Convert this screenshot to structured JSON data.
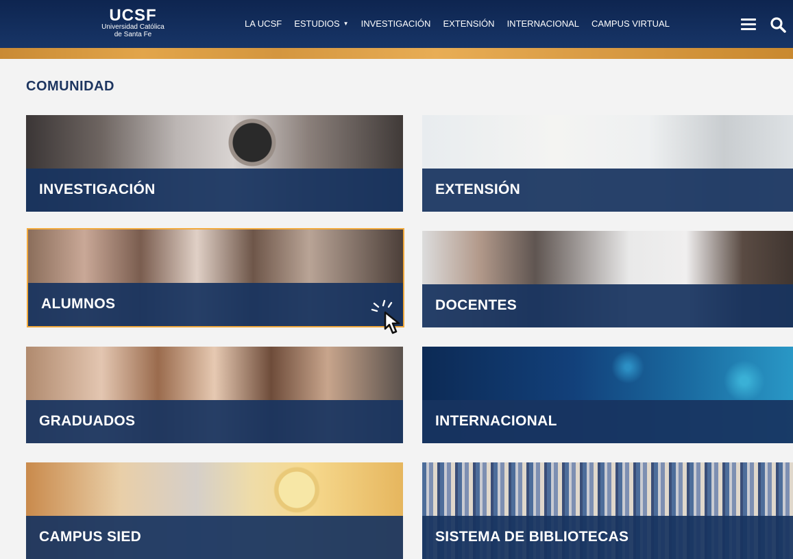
{
  "header": {
    "logo": {
      "name": "UCSF",
      "subtitle_line1": "Universidad Católica",
      "subtitle_line2": "de Santa Fe"
    },
    "nav": [
      {
        "label": "LA UCSF"
      },
      {
        "label": "ESTUDIOS",
        "has_dropdown": true
      },
      {
        "label": "INVESTIGACIÓN"
      },
      {
        "label": "EXTENSIÓN"
      },
      {
        "label": "INTERNACIONAL"
      },
      {
        "label": "CAMPUS VIRTUAL"
      }
    ],
    "icons": [
      "menu-icon",
      "search-icon"
    ],
    "colors": {
      "bar": "#14305f",
      "accent_stripe": "#e2a54a"
    }
  },
  "main": {
    "section_title": "COMUNIDAD",
    "cards": [
      {
        "label": "INVESTIGACIÓN"
      },
      {
        "label": "EXTENSIÓN"
      },
      {
        "label": "ALUMNOS",
        "highlighted": true
      },
      {
        "label": "DOCENTES"
      },
      {
        "label": "GRADUADOS"
      },
      {
        "label": "INTERNACIONAL"
      },
      {
        "label": "CAMPUS SIED"
      },
      {
        "label": "SISTEMA DE BIBLIOTECAS"
      }
    ],
    "colors": {
      "label_band": "#183460",
      "highlight_border": "#f2a93b",
      "title": "#1d3560"
    }
  },
  "pointer": {
    "icon": "hand-cursor-icon",
    "over_card": "ALUMNOS"
  }
}
